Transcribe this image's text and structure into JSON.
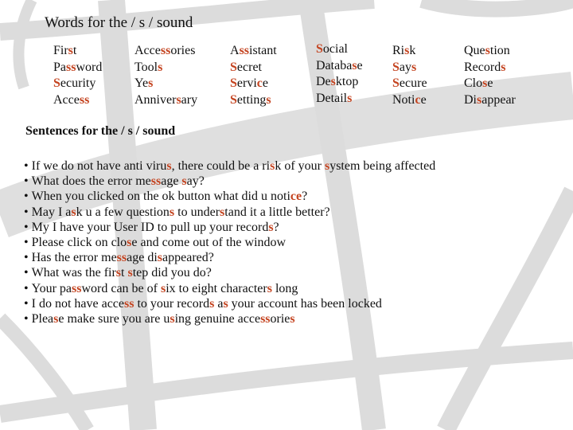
{
  "colors": {
    "highlight": "#c4431f",
    "text": "#111111",
    "watermark": "#dcdcdc",
    "background": "#ffffff"
  },
  "words_heading": "Words for the / s / sound",
  "word_columns": [
    {
      "words": [
        [
          [
            "Fir",
            ""
          ],
          [
            "s",
            "hl"
          ],
          [
            "t",
            ""
          ]
        ],
        [
          [
            "Pa",
            ""
          ],
          [
            "ss",
            "hl"
          ],
          [
            "word",
            ""
          ]
        ],
        [
          [
            "S",
            "hl"
          ],
          [
            "ecurity",
            ""
          ]
        ],
        [
          [
            "Acce",
            ""
          ],
          [
            "ss",
            "hl"
          ]
        ]
      ]
    },
    {
      "words": [
        [
          [
            "Acce",
            ""
          ],
          [
            "ss",
            "hl"
          ],
          [
            "ories",
            ""
          ]
        ],
        [
          [
            "Tool",
            ""
          ],
          [
            "s",
            "hl"
          ]
        ],
        [
          [
            "Ye",
            ""
          ],
          [
            "s",
            "hl"
          ]
        ],
        [
          [
            "Anniver",
            ""
          ],
          [
            "s",
            "hl"
          ],
          [
            "ary",
            ""
          ]
        ]
      ]
    },
    {
      "words": [
        [
          [
            "A",
            ""
          ],
          [
            "ss",
            "hl"
          ],
          [
            "istant",
            ""
          ]
        ],
        [
          [
            "S",
            "hl"
          ],
          [
            "ecret",
            ""
          ]
        ],
        [
          [
            "S",
            "hl"
          ],
          [
            "ervi",
            ""
          ],
          [
            "c",
            "hl"
          ],
          [
            "e",
            ""
          ]
        ],
        [
          [
            "S",
            "hl"
          ],
          [
            "etting",
            ""
          ],
          [
            "s",
            "hl"
          ]
        ]
      ]
    },
    {
      "words": [
        [
          [
            "S",
            "hl"
          ],
          [
            "ocial",
            ""
          ]
        ],
        [
          [
            "Databa",
            ""
          ],
          [
            "s",
            "hl"
          ],
          [
            "e",
            ""
          ]
        ],
        [
          [
            "De",
            ""
          ],
          [
            "s",
            "hl"
          ],
          [
            "ktop",
            ""
          ]
        ],
        [
          [
            "Detail",
            ""
          ],
          [
            "s",
            "hl"
          ]
        ]
      ]
    },
    {
      "words": [
        [
          [
            "Ri",
            ""
          ],
          [
            "s",
            "hl"
          ],
          [
            "k",
            ""
          ]
        ],
        [
          [
            "S",
            "hl"
          ],
          [
            "ay",
            ""
          ],
          [
            "s",
            "hl"
          ]
        ],
        [
          [
            "S",
            "hl"
          ],
          [
            "ecure",
            ""
          ]
        ],
        [
          [
            "Noti",
            ""
          ],
          [
            "c",
            "hl"
          ],
          [
            "e",
            ""
          ]
        ]
      ]
    },
    {
      "words": [
        [
          [
            "Que",
            ""
          ],
          [
            "s",
            "hl"
          ],
          [
            "tion",
            ""
          ]
        ],
        [
          [
            "Record",
            ""
          ],
          [
            "s",
            "hl"
          ]
        ],
        [
          [
            "Clo",
            ""
          ],
          [
            "s",
            "hl"
          ],
          [
            "e",
            ""
          ]
        ],
        [
          [
            "Di",
            ""
          ],
          [
            "s",
            "hl"
          ],
          [
            "appear",
            ""
          ]
        ]
      ]
    }
  ],
  "sentences_heading": "Sentences for the / s  / sound",
  "sentences": [
    [
      [
        "If  we do not have anti viru",
        ""
      ],
      [
        "s",
        "hl"
      ],
      [
        ", there could be a ri",
        ""
      ],
      [
        "s",
        "hl"
      ],
      [
        "k of your ",
        ""
      ],
      [
        "s",
        "hl"
      ],
      [
        "ystem being affected",
        ""
      ]
    ],
    [
      [
        "What does the error me",
        ""
      ],
      [
        "ss",
        "hl"
      ],
      [
        "age ",
        ""
      ],
      [
        "s",
        "hl"
      ],
      [
        "ay?",
        ""
      ]
    ],
    [
      [
        "When you clicked on the ok button what did u noti",
        ""
      ],
      [
        "ce",
        "hl"
      ],
      [
        "?",
        ""
      ]
    ],
    [
      [
        "May I a",
        ""
      ],
      [
        "s",
        "hl"
      ],
      [
        "k u a few question",
        ""
      ],
      [
        "s",
        "hl"
      ],
      [
        " to under",
        ""
      ],
      [
        "s",
        "hl"
      ],
      [
        "tand it a little better?",
        ""
      ]
    ],
    [
      [
        "My I have your User ID to pull up your record",
        ""
      ],
      [
        "s",
        "hl"
      ],
      [
        "?",
        ""
      ]
    ],
    [
      [
        "Please click on clo",
        ""
      ],
      [
        "s",
        "hl"
      ],
      [
        "e and come out of the window",
        ""
      ]
    ],
    [
      [
        "Has the error me",
        ""
      ],
      [
        "ss",
        "hl"
      ],
      [
        "age di",
        ""
      ],
      [
        "s",
        "hl"
      ],
      [
        "appeared?",
        ""
      ]
    ],
    [
      [
        "What was the fir",
        ""
      ],
      [
        "s",
        "hl"
      ],
      [
        "t ",
        ""
      ],
      [
        "s",
        "hl"
      ],
      [
        "tep did you do?",
        ""
      ]
    ],
    [
      [
        "Your pa",
        ""
      ],
      [
        "ss",
        "hl"
      ],
      [
        "word can be of ",
        ""
      ],
      [
        "s",
        "hl"
      ],
      [
        "ix to eight character",
        ""
      ],
      [
        "s",
        "hl"
      ],
      [
        " long",
        ""
      ]
    ],
    [
      [
        "I do not have acce",
        ""
      ],
      [
        "ss",
        "hl"
      ],
      [
        " to your record",
        ""
      ],
      [
        "s",
        "hl"
      ],
      [
        " a",
        ""
      ],
      [
        "s",
        "hl"
      ],
      [
        " your account has been locked",
        ""
      ]
    ],
    [
      [
        "Plea",
        ""
      ],
      [
        "s",
        "hl"
      ],
      [
        "e make sure you are u",
        ""
      ],
      [
        "s",
        "hl"
      ],
      [
        "ing genuine acce",
        ""
      ],
      [
        "ss",
        "hl"
      ],
      [
        "orie",
        ""
      ],
      [
        "s",
        "hl"
      ]
    ]
  ]
}
